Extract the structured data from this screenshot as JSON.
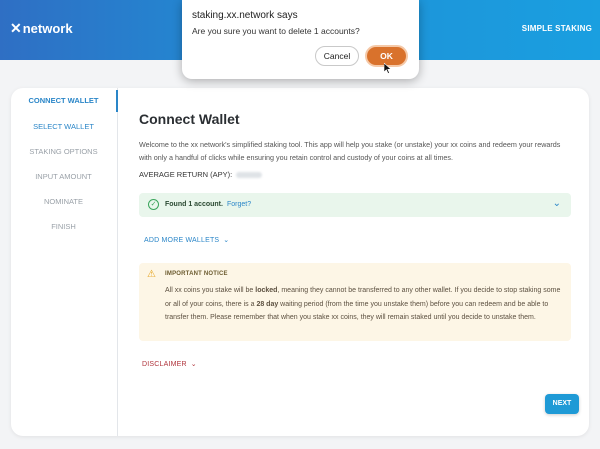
{
  "header": {
    "logo_text": "network",
    "logo_mark": "✕",
    "right_label": "SIMPLE STAKING"
  },
  "sidebar": {
    "steps": [
      {
        "label": "CONNECT WALLET",
        "state": "active"
      },
      {
        "label": "SELECT WALLET",
        "state": "current"
      },
      {
        "label": "STAKING OPTIONS",
        "state": "pending"
      },
      {
        "label": "INPUT AMOUNT",
        "state": "pending"
      },
      {
        "label": "NOMINATE",
        "state": "pending"
      },
      {
        "label": "FINISH",
        "state": "pending"
      }
    ]
  },
  "main": {
    "title": "Connect Wallet",
    "intro": "Welcome to the xx network's simplified staking tool. This app will help you stake (or unstake) your xx coins and redeem your rewards with only a handful of clicks while ensuring you retain control and custody of your coins at all times.",
    "apy_label": "AVERAGE RETURN (APY):",
    "found_text": "Found 1 account.",
    "found_link": "Forget?",
    "add_more": "ADD MORE WALLETS",
    "notice_title": "IMPORTANT NOTICE",
    "notice_body_1": "All xx coins you stake will be ",
    "notice_bold_1": "locked",
    "notice_body_2": ", meaning they cannot be transferred to any other wallet. If you decide to stop staking some or all of your coins, there is a ",
    "notice_bold_2": "28 day",
    "notice_body_3": " waiting period (from the time you unstake them) before you can redeem and be able to transfer them. Please remember that when you stake xx coins, they will remain staked until you decide to unstake them.",
    "disclaimer": "DISCLAIMER",
    "next": "NEXT"
  },
  "dialog": {
    "title": "staking.xx.network says",
    "message": "Are you sure you want to delete 1 accounts?",
    "cancel": "Cancel",
    "ok": "OK"
  },
  "colors": {
    "accent": "#2a86c8",
    "ok_button": "#d9722c",
    "success_bg": "#e9f6ec",
    "notice_bg": "#fdf6e6",
    "disclaimer": "#b0343c"
  }
}
